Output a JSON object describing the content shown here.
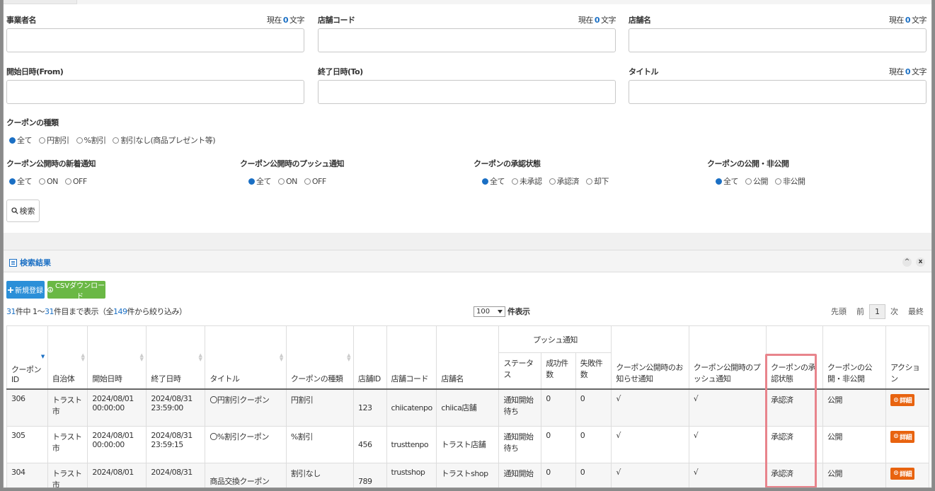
{
  "form": {
    "row1": [
      {
        "label": "事業者名",
        "count_prefix": "現在",
        "count": "0",
        "count_suffix": "文字"
      },
      {
        "label": "店舗コード",
        "count_prefix": "現在",
        "count": "0",
        "count_suffix": "文字"
      },
      {
        "label": "店舗名",
        "count_prefix": "現在",
        "count": "0",
        "count_suffix": "文字"
      }
    ],
    "row2": [
      {
        "label": "開始日時(From)"
      },
      {
        "label": "終了日時(To)"
      },
      {
        "label": "タイトル",
        "count_prefix": "現在",
        "count": "0",
        "count_suffix": "文字"
      }
    ],
    "coupon_type": {
      "label": "クーポンの種類",
      "options": [
        "全て",
        "円割引",
        "%割引",
        "割引なし(商品プレゼント等)"
      ],
      "selected": 0
    },
    "groups": [
      {
        "label": "クーポン公開時の新着通知",
        "options": [
          "全て",
          "ON",
          "OFF"
        ],
        "selected": 0
      },
      {
        "label": "クーポン公開時のプッシュ通知",
        "options": [
          "全て",
          "ON",
          "OFF"
        ],
        "selected": 0
      },
      {
        "label": "クーポンの承認状態",
        "options": [
          "全て",
          "未承認",
          "承認済",
          "却下"
        ],
        "selected": 0
      },
      {
        "label": "クーポンの公開・非公開",
        "options": [
          "全て",
          "公開",
          "非公開"
        ],
        "selected": 0
      }
    ],
    "search_label": "検索"
  },
  "results": {
    "title": "検索結果",
    "collapse_glyph": "^",
    "close_glyph": "x",
    "new_label": "新規登録",
    "csv_label": "CSVダウンロード",
    "summary": {
      "total": "31",
      "mid1": "件中 1～",
      "shown": "31",
      "mid2": "件目まで表示（全",
      "all": "149",
      "mid3": "件から絞り込み）"
    },
    "per_page": {
      "value": "100",
      "label": "件表示"
    },
    "pager": {
      "first": "先頭",
      "prev": "前",
      "current": "1",
      "next": "次",
      "last": "最終"
    }
  },
  "table": {
    "headers": {
      "id": "クーポンID",
      "city": "自治体",
      "start": "開始日時",
      "end": "終了日時",
      "title": "タイトル",
      "type": "クーポンの種類",
      "store_id": "店舗ID",
      "store_code": "店舗コード",
      "store_name": "店舗名",
      "push_group": "プッシュ通知",
      "push_status": "ステータス",
      "push_ok": "成功件数",
      "push_ng": "失敗件数",
      "notice": "クーポン公開時のお知らせ通知",
      "push": "クーポン公開時のプッシュ通知",
      "approval": "クーポンの承認状態",
      "publish": "クーポンの公開・非公開",
      "action": "アクション"
    },
    "detail_label": "詳細",
    "rows": [
      {
        "id": "306",
        "city": "トラスト市",
        "start": "2024/08/01 00:00:00",
        "end": "2024/08/31 23:59:00",
        "title": "〇円割引クーポン",
        "type": "円割引",
        "store_id": "123",
        "store_code": "chiicatenpo",
        "store_name": "chiica店舗",
        "push_status": "通知開始待ち",
        "push_ok": "0",
        "push_ng": "0",
        "notice": "√",
        "push": "√",
        "approval": "承認済",
        "publish": "公開"
      },
      {
        "id": "305",
        "city": "トラスト市",
        "start": "2024/08/01 00:00:00",
        "end": "2024/08/31 23:59:15",
        "title": "〇%割引クーポン",
        "type": "%割引",
        "store_id": "456",
        "store_code": "trusttenpo",
        "store_name": "トラスト店舗",
        "push_status": "通知開始待ち",
        "push_ok": "0",
        "push_ng": "0",
        "notice": "√",
        "push": "√",
        "approval": "承認済",
        "publish": "公開"
      },
      {
        "id": "304",
        "city": "トラスト市",
        "start": "2024/08/01",
        "end": "2024/08/31",
        "title": "商品交換クーポン",
        "type": "割引なし",
        "store_id": "789",
        "store_code": "trustshop",
        "store_name": "トラストshop",
        "push_status": "通知開始",
        "push_ok": "0",
        "push_ng": "0",
        "notice": "√",
        "push": "√",
        "approval": "承認済",
        "publish": "公開"
      }
    ]
  },
  "colors": {
    "accent": "#1a6fc4",
    "new_btn": "#2b8fd8",
    "csv_btn": "#6ab845",
    "detail_btn": "#e8630f",
    "highlight": "#e8848c"
  }
}
